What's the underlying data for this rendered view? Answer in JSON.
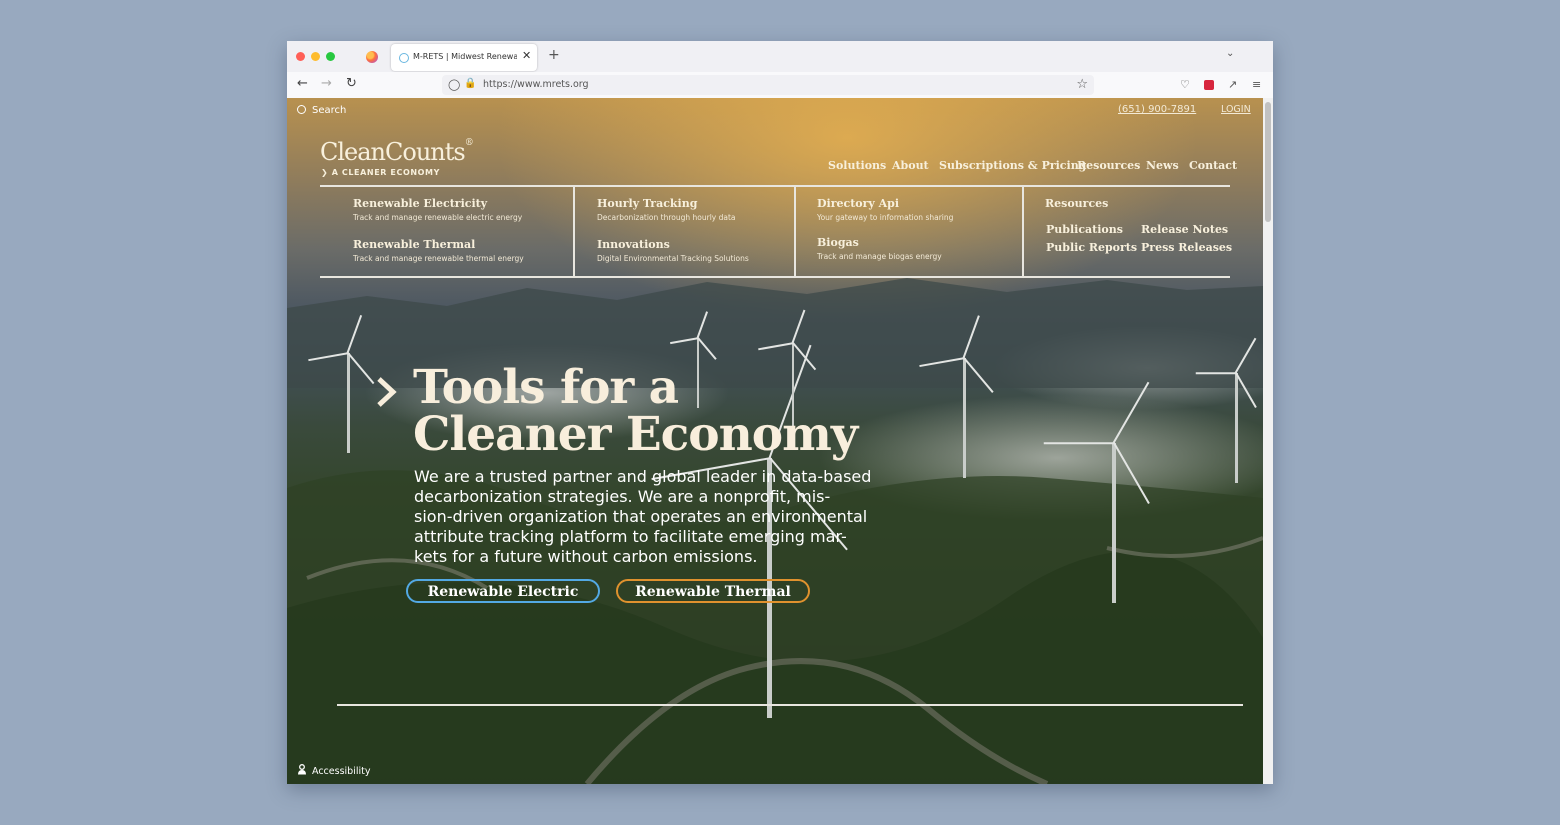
{
  "browser": {
    "tab_title": "M-RETS | Midwest Renewable E",
    "tab_close": "✕",
    "new_tab": "+",
    "url": "https://www.mrets.org",
    "icons": [
      "back-icon",
      "forward-icon",
      "reload-icon",
      "shield-icon",
      "lock-icon",
      "star-icon",
      "pocket-icon",
      "extension-icon",
      "share-icon",
      "menu-icon"
    ]
  },
  "header": {
    "search_label": "Search",
    "phone": "(651) 900-7891",
    "login": "LOGIN",
    "logo": "CleanCounts",
    "logo_mark": "®",
    "tagline": "A CLEANER ECONOMY",
    "nav": [
      "Solutions",
      "About",
      "Subscriptions & Pricing",
      "Resources",
      "News",
      "Contact"
    ]
  },
  "menu": {
    "col1": [
      {
        "title": "Renewable Electricity",
        "desc": "Track and manage renewable electric energy"
      },
      {
        "title": "Renewable Thermal",
        "desc": "Track and manage renewable thermal energy"
      }
    ],
    "col2": [
      {
        "title": "Hourly Tracking",
        "desc": "Decarbonization through hourly data"
      },
      {
        "title": "Innovations",
        "desc": "Digital Environmental Tracking Solutions"
      }
    ],
    "col3": [
      {
        "title": "Directory Api",
        "desc": "Your gateway to information sharing"
      },
      {
        "title": "Biogas",
        "desc": "Track and manage biogas energy"
      }
    ],
    "col4": {
      "title": "Resources",
      "links": [
        "Publications",
        "Release Notes",
        "Public Reports",
        "Press Releases"
      ]
    }
  },
  "hero": {
    "title_line1": "Tools for a",
    "title_line2": "Cleaner Economy",
    "body_lines": [
      "We are a trusted partner and global leader in data-based",
      "decarbonization strategies. We are a nonprofit, mis-",
      "sion-driven organization that operates an environmental",
      "attribute tracking platform to facilitate emerging mar-",
      "kets for a future without carbon emissions."
    ],
    "btn_electric": "Renewable Electric",
    "btn_thermal": "Renewable Thermal"
  },
  "footer": {
    "accessibility": "Accessibility"
  },
  "colors": {
    "cream": "#f8f0dc",
    "electric_border": "#53a9e4",
    "thermal_border": "#e0922e",
    "page_bg": "#98a9bf"
  }
}
